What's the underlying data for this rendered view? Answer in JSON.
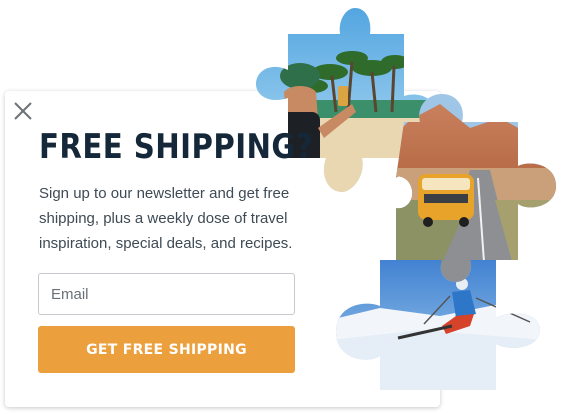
{
  "popup": {
    "heading": "FREE SHIPPING?",
    "description": "Sign up to our newsletter and get free shipping, plus a weekly dose of travel inspiration, special deals, and recipes.",
    "email_placeholder": "Email",
    "email_value": "",
    "cta_label": "GET FREE SHIPPING",
    "close_icon": "close-icon"
  },
  "colors": {
    "heading": "#15283a",
    "text": "#3e4a55",
    "cta_background": "#ec9f3d",
    "cta_text": "#ffffff"
  },
  "images": [
    {
      "name": "puzzle-piece-beach-photo",
      "subject": "beach-palms"
    },
    {
      "name": "puzzle-piece-desert-van-photo",
      "subject": "desert-road-van"
    },
    {
      "name": "puzzle-piece-skier-photo",
      "subject": "skiing"
    }
  ]
}
